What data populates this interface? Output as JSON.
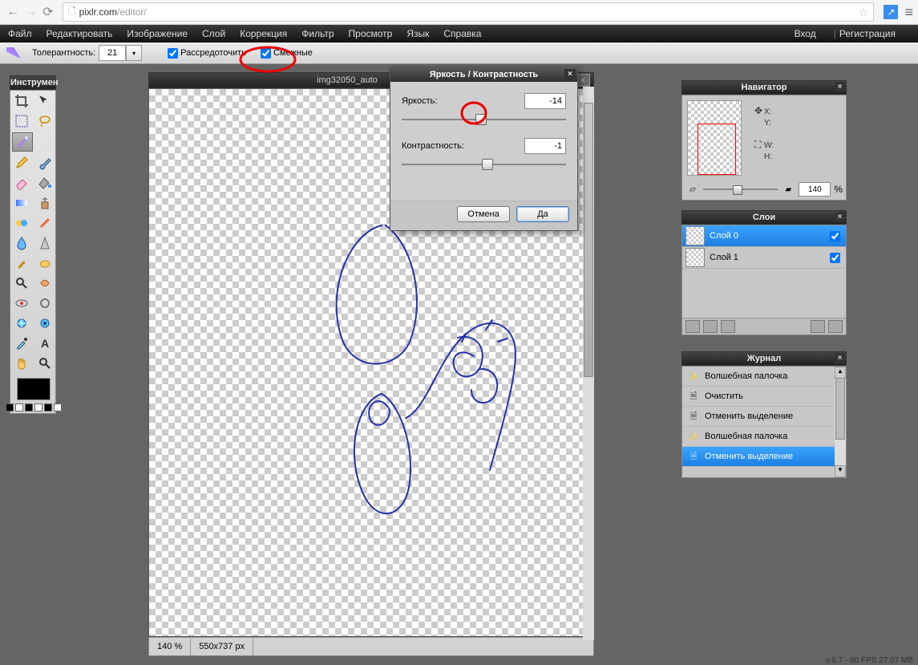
{
  "browser": {
    "url_host": "pixlr.com",
    "url_path": "/editor/"
  },
  "menubar": {
    "items": [
      "Файл",
      "Редактировать",
      "Изображение",
      "Слой",
      "Коррекция",
      "Фильтр",
      "Просмотр",
      "Язык",
      "Справка"
    ],
    "login": "Вход",
    "register": "Регистрация"
  },
  "options": {
    "tolerance_label": "Толерантность:",
    "tolerance_value": "21",
    "contiguous_label": "Рассредоточить",
    "adjacent_label": "Смежные"
  },
  "tools_panel_title": "Инструмен",
  "document": {
    "title": "img32050_auto",
    "zoom": "140 %",
    "dimensions": "550x737 px"
  },
  "dialog": {
    "title": "Яркость / Контрастность",
    "brightness_label": "Яркость:",
    "brightness_value": "-14",
    "contrast_label": "Контрастность:",
    "contrast_value": "-1",
    "cancel": "Отмена",
    "ok": "Да"
  },
  "navigator": {
    "title": "Навигатор",
    "x": "X:",
    "y": "Y:",
    "w": "W:",
    "h": "H:",
    "zoom": "140",
    "pct": "%"
  },
  "layers": {
    "title": "Слои",
    "items": [
      {
        "name": "Слой 0",
        "selected": true
      },
      {
        "name": "Слой 1",
        "selected": false
      }
    ]
  },
  "history": {
    "title": "Журнал",
    "items": [
      {
        "name": "Волшебная палочка",
        "icon": "wand"
      },
      {
        "name": "Очистить",
        "icon": "doc"
      },
      {
        "name": "Отменить выделение",
        "icon": "doc"
      },
      {
        "name": "Волшебная палочка",
        "icon": "wand"
      },
      {
        "name": "Отменить выделение",
        "icon": "doc",
        "selected": true
      }
    ]
  },
  "footer": "v.6.7 - 60 FPS 27.07 MB"
}
